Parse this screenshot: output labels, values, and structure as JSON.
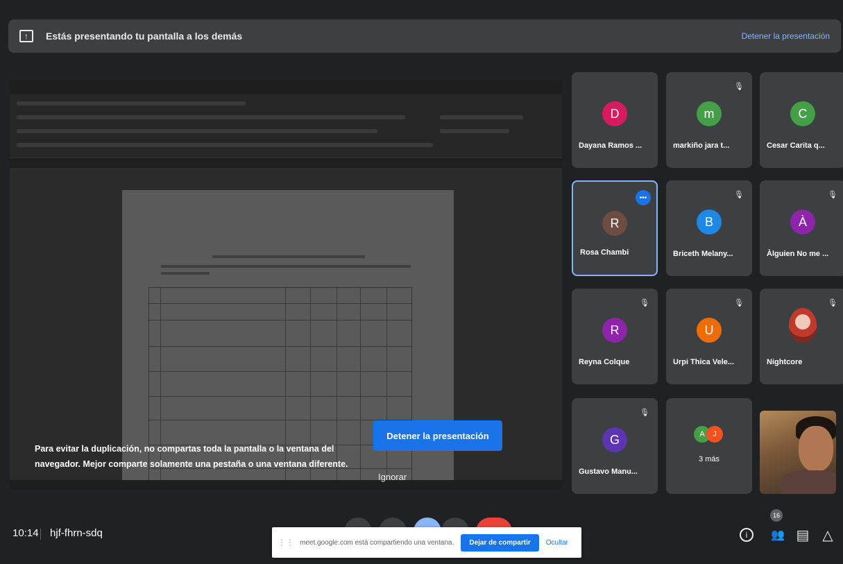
{
  "banner": {
    "text": "Estás presentando tu pantalla a los demás",
    "stop_link": "Detener la presentación",
    "icon": "present-to-all-icon"
  },
  "overlay": {
    "warning": "Para evitar la duplicación, no compartas toda la pantalla o la ventana del navegador. Mejor comparte solamente una pestaña o una ventana diferente.",
    "stop_button": "Detener la presentación",
    "ignore": "Ignorar"
  },
  "participants": [
    {
      "initial": "D",
      "name": "Dayana Ramos ...",
      "color": "#d81b60",
      "muted": false
    },
    {
      "initial": "m",
      "name": "markiño jara t...",
      "color": "#43a047",
      "muted": true
    },
    {
      "initial": "C",
      "name": "Cesar Carita q...",
      "color": "#43a047",
      "muted": false
    },
    {
      "initial": "R",
      "name": "Rosa Chambi",
      "color": "#6d4c41",
      "muted": false,
      "active": true
    },
    {
      "initial": "B",
      "name": "Briceth Melany...",
      "color": "#1e88e5",
      "muted": true
    },
    {
      "initial": "À",
      "name": "Àlguien No me ...",
      "color": "#8e24aa",
      "muted": true
    },
    {
      "initial": "R",
      "name": "Reyna Colque",
      "color": "#8e24aa",
      "muted": true
    },
    {
      "initial": "U",
      "name": "Urpi Thica Vele...",
      "color": "#ef6c00",
      "muted": true
    },
    {
      "initial": "",
      "name": "Nightcore",
      "color": "#c0392b",
      "muted": true
    },
    {
      "initial": "G",
      "name": "Gustavo Manu...",
      "color": "#5e35b1",
      "muted": true
    }
  ],
  "more": {
    "a_initial": "A",
    "a_color": "#43a047",
    "j_initial": "J",
    "j_color": "#f4511e",
    "label": "3 más"
  },
  "bottom": {
    "time": "10:14",
    "meeting_code": "hjf-fhrn-sdq",
    "participant_count": "16"
  },
  "share_bar": {
    "text": "meet.google.com está compartiendo una ventana.",
    "stop_button": "Dejar de compartir",
    "hide": "Ocultar"
  },
  "icons": {
    "more_options": "•••",
    "mute": "🎙",
    "info": "i",
    "people": "👥",
    "chat": "▤",
    "activities": "△"
  }
}
